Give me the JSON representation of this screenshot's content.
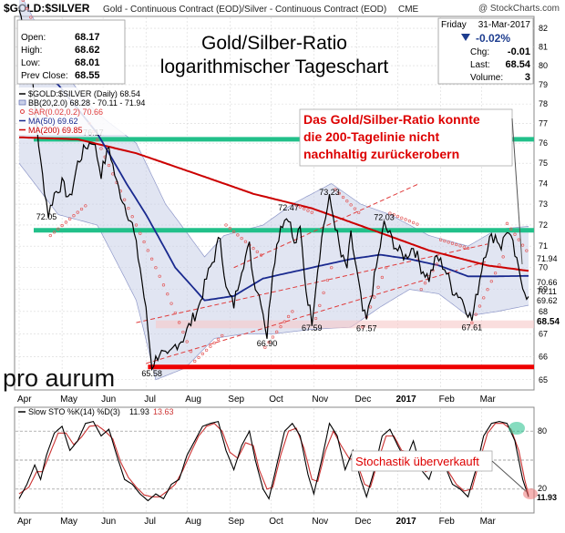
{
  "header": {
    "symbol": "$GOLD:$SILVER",
    "description": "Gold - Continuous Contract (EOD)/Silver - Continuous Contract (EOD)",
    "exchange": "CME",
    "copyright": "@ StockCharts.com"
  },
  "quote_box": {
    "open_label": "Open:",
    "open": "68.17",
    "high_label": "High:",
    "high": "68.62",
    "low_label": "Low:",
    "low": "68.01",
    "prev_label": "Prev Close:",
    "prev": "68.55"
  },
  "chart_title": {
    "line1": "Gold/Silber-Ratio",
    "line2": "logarithmischer Tageschart"
  },
  "right_box": {
    "day": "Friday",
    "date": "31-Mar-2017",
    "change_pct": "-0.02%",
    "chg_label": "Chg:",
    "chg": "-0.01",
    "last_label": "Last:",
    "last": "68.54",
    "vol_label": "Volume:",
    "vol": "3"
  },
  "legend": [
    {
      "text": "$GOLD:$SILVER (Daily) 68.54",
      "color": "#000000"
    },
    {
      "text": "BB(20,2.0) 68.28 - 70.11 - 71.94",
      "color": "#4b5aa6"
    },
    {
      "text": "SAR(0.02,0.2) 70.66",
      "color": "#e03b3b"
    },
    {
      "text": "MA(50) 69.62",
      "color": "#1a2a8f"
    },
    {
      "text": "MA(200) 69.85",
      "color": "#cc0000"
    }
  ],
  "annotation_main": {
    "line1": "Das Gold/Silber-Ratio konnte",
    "line2": "die 200-Tagelinie nicht",
    "line3": "nachhaltig zurückerobern"
  },
  "annotation_stoch": "Stochastik überverkauft",
  "watermark": "pro aurum",
  "right_value_labels": [
    "71.94",
    "70.66",
    "70.11",
    "69.62",
    "68.54"
  ],
  "stoch_legend": {
    "label": "Slow STO %K(14) %D(3)",
    "k": "11.93",
    "d": "13.63"
  },
  "stoch_right_label": "11.93",
  "stoch_ticks": [
    "80",
    "20"
  ],
  "colors": {
    "price": "#000000",
    "ma50": "#1a2a8f",
    "ma200": "#cc0000",
    "sar": "#e35a5a",
    "bb_fill": "#c9cfe8",
    "green": "#22c08a",
    "red": "#ee0000",
    "annotation": "#dd0000",
    "grid": "#d8d8d8"
  },
  "chart_data": {
    "type": "line",
    "y_scale": "log",
    "ylim": [
      64.6,
      82.6
    ],
    "yticks": [
      65,
      66,
      67,
      68,
      69,
      70,
      71,
      72,
      73,
      74,
      75,
      76,
      77,
      78,
      79,
      80,
      81,
      82
    ],
    "x_months": [
      {
        "label": "Apr",
        "i": 0
      },
      {
        "label": "May",
        "i": 22
      },
      {
        "label": "Jun",
        "i": 43
      },
      {
        "label": "Jul",
        "i": 65
      },
      {
        "label": "Aug",
        "i": 86
      },
      {
        "label": "Sep",
        "i": 108
      },
      {
        "label": "Oct",
        "i": 129
      },
      {
        "label": "Nov",
        "i": 151
      },
      {
        "label": "Dec",
        "i": 173
      },
      {
        "label": "2017",
        "i": 194
      },
      {
        "label": "Feb",
        "i": 216
      },
      {
        "label": "Mar",
        "i": 237
      }
    ],
    "n_days": 262,
    "price_keypoints": [
      [
        0,
        83.0
      ],
      [
        4,
        81.5
      ],
      [
        8,
        78.0
      ],
      [
        11,
        75.0
      ],
      [
        15,
        72.5
      ],
      [
        18,
        73.5
      ],
      [
        22,
        74.0
      ],
      [
        26,
        73.2
      ],
      [
        30,
        75.0
      ],
      [
        34,
        75.8
      ],
      [
        38,
        76.17
      ],
      [
        42,
        74.5
      ],
      [
        46,
        75.8
      ],
      [
        50,
        74.0
      ],
      [
        54,
        73.0
      ],
      [
        58,
        72.0
      ],
      [
        62,
        70.0
      ],
      [
        65,
        68.0
      ],
      [
        68,
        65.58
      ],
      [
        72,
        66.2
      ],
      [
        76,
        65.9
      ],
      [
        80,
        66.5
      ],
      [
        84,
        66.8
      ],
      [
        88,
        67.5
      ],
      [
        92,
        68.2
      ],
      [
        96,
        69.5
      ],
      [
        100,
        70.5
      ],
      [
        103,
        71.5
      ],
      [
        106,
        69.0
      ],
      [
        110,
        68.3
      ],
      [
        114,
        70.0
      ],
      [
        118,
        71.0
      ],
      [
        120,
        69.5
      ],
      [
        124,
        68.5
      ],
      [
        127,
        66.9
      ],
      [
        130,
        70.0
      ],
      [
        134,
        72.0
      ],
      [
        138,
        72.47
      ],
      [
        141,
        71.0
      ],
      [
        144,
        71.8
      ],
      [
        147,
        69.0
      ],
      [
        150,
        67.59
      ],
      [
        153,
        70.0
      ],
      [
        156,
        72.0
      ],
      [
        159,
        73.23
      ],
      [
        162,
        72.0
      ],
      [
        165,
        70.5
      ],
      [
        168,
        70.0
      ],
      [
        170,
        71.5
      ],
      [
        173,
        69.8
      ],
      [
        176,
        68.0
      ],
      [
        178,
        67.57
      ],
      [
        181,
        69.0
      ],
      [
        184,
        70.5
      ],
      [
        187,
        72.03
      ],
      [
        190,
        71.5
      ],
      [
        194,
        70.8
      ],
      [
        198,
        70.5
      ],
      [
        202,
        71.0
      ],
      [
        206,
        70.0
      ],
      [
        210,
        69.5
      ],
      [
        214,
        70.5
      ],
      [
        218,
        70.0
      ],
      [
        222,
        69.0
      ],
      [
        226,
        68.7
      ],
      [
        230,
        68.0
      ],
      [
        232,
        67.61
      ],
      [
        235,
        69.0
      ],
      [
        238,
        70.5
      ],
      [
        241,
        71.3
      ],
      [
        244,
        71.5
      ],
      [
        247,
        71.0
      ],
      [
        250,
        71.8
      ],
      [
        253,
        71.0
      ],
      [
        256,
        69.8
      ],
      [
        259,
        69.0
      ],
      [
        261,
        68.54
      ]
    ],
    "ma50_keypoints": [
      [
        0,
        80.5
      ],
      [
        20,
        79.0
      ],
      [
        40,
        76.5
      ],
      [
        55,
        74.0
      ],
      [
        65,
        72.5
      ],
      [
        80,
        70.0
      ],
      [
        95,
        68.5
      ],
      [
        110,
        68.7
      ],
      [
        125,
        69.5
      ],
      [
        140,
        69.8
      ],
      [
        155,
        70.1
      ],
      [
        170,
        70.4
      ],
      [
        185,
        70.6
      ],
      [
        200,
        70.4
      ],
      [
        215,
        70.1
      ],
      [
        230,
        69.6
      ],
      [
        245,
        69.6
      ],
      [
        261,
        69.62
      ]
    ],
    "ma200_keypoints": [
      [
        0,
        76.3
      ],
      [
        30,
        76.2
      ],
      [
        60,
        75.5
      ],
      [
        90,
        74.5
      ],
      [
        120,
        73.5
      ],
      [
        150,
        72.8
      ],
      [
        180,
        71.8
      ],
      [
        210,
        70.8
      ],
      [
        240,
        70.1
      ],
      [
        261,
        69.85
      ]
    ],
    "bb_upper_keypoints": [
      [
        0,
        84.0
      ],
      [
        20,
        80.0
      ],
      [
        40,
        77.5
      ],
      [
        60,
        76.0
      ],
      [
        75,
        73.0
      ],
      [
        95,
        70.5
      ],
      [
        105,
        71.5
      ],
      [
        125,
        72.0
      ],
      [
        140,
        73.0
      ],
      [
        160,
        74.0
      ],
      [
        175,
        73.0
      ],
      [
        190,
        72.5
      ],
      [
        210,
        71.5
      ],
      [
        230,
        71.0
      ],
      [
        245,
        71.8
      ],
      [
        261,
        71.94
      ]
    ],
    "bb_lower_keypoints": [
      [
        0,
        75.0
      ],
      [
        20,
        72.5
      ],
      [
        40,
        72.0
      ],
      [
        60,
        68.5
      ],
      [
        70,
        65.0
      ],
      [
        85,
        65.5
      ],
      [
        100,
        66.8
      ],
      [
        115,
        67.0
      ],
      [
        130,
        67.0
      ],
      [
        150,
        67.2
      ],
      [
        170,
        67.3
      ],
      [
        185,
        68.2
      ],
      [
        200,
        69.0
      ],
      [
        215,
        68.8
      ],
      [
        230,
        67.8
      ],
      [
        245,
        68.0
      ],
      [
        261,
        68.28
      ]
    ],
    "sar_keypoints": [
      [
        0,
        84.0
      ],
      [
        15,
        80.5
      ],
      [
        16,
        71.5
      ],
      [
        35,
        73.0
      ],
      [
        36,
        77.0
      ],
      [
        55,
        73.0
      ],
      [
        75,
        69.0
      ],
      [
        90,
        65.8
      ],
      [
        105,
        67.0
      ],
      [
        106,
        72.0
      ],
      [
        125,
        70.5
      ],
      [
        126,
        66.4
      ],
      [
        140,
        68.0
      ],
      [
        141,
        73.0
      ],
      [
        150,
        72.6
      ],
      [
        151,
        67.4
      ],
      [
        160,
        70.0
      ],
      [
        161,
        73.8
      ],
      [
        175,
        72.5
      ],
      [
        176,
        67.3
      ],
      [
        188,
        70.0
      ],
      [
        189,
        72.6
      ],
      [
        205,
        72.0
      ],
      [
        206,
        69.0
      ],
      [
        215,
        70.3
      ],
      [
        216,
        71.3
      ],
      [
        230,
        70.9
      ],
      [
        231,
        67.3
      ],
      [
        248,
        70.5
      ],
      [
        249,
        72.2
      ],
      [
        261,
        70.66
      ]
    ],
    "peak_labels": [
      {
        "i": 38,
        "v": 76.17,
        "text": "76.17"
      },
      {
        "i": 14,
        "v": 72.05,
        "text": "72.05"
      },
      {
        "i": 68,
        "v": 65.58,
        "text": "65.58"
      },
      {
        "i": 127,
        "v": 66.9,
        "text": "66.90"
      },
      {
        "i": 138,
        "v": 72.47,
        "text": "72.47"
      },
      {
        "i": 150,
        "v": 67.59,
        "text": "67.59"
      },
      {
        "i": 159,
        "v": 73.23,
        "text": "73.23"
      },
      {
        "i": 178,
        "v": 67.57,
        "text": "67.57"
      },
      {
        "i": 187,
        "v": 72.03,
        "text": "72.03"
      },
      {
        "i": 232,
        "v": 67.61,
        "text": "67.61"
      }
    ],
    "horizontal_lines": [
      {
        "value": 76.2,
        "color": "#22c08a"
      },
      {
        "value": 71.75,
        "color": "#22c08a"
      },
      {
        "value": 65.55,
        "color": "#ee0000"
      }
    ],
    "pink_band": [
      67.25,
      67.6
    ],
    "trendlines": [
      {
        "from": [
          65,
          65.7
        ],
        "to": [
          240,
          70.3
        ]
      },
      {
        "from": [
          60,
          67.5
        ],
        "to": [
          240,
          71.1
        ]
      },
      {
        "from": [
          110,
          70.0
        ],
        "to": [
          205,
          74.0
        ]
      }
    ],
    "stochastic": {
      "ylim": [
        0,
        100
      ],
      "k_keypoints": [
        [
          0,
          10
        ],
        [
          4,
          25
        ],
        [
          8,
          45
        ],
        [
          11,
          30
        ],
        [
          14,
          55
        ],
        [
          18,
          78
        ],
        [
          22,
          85
        ],
        [
          26,
          60
        ],
        [
          30,
          70
        ],
        [
          34,
          88
        ],
        [
          38,
          90
        ],
        [
          42,
          75
        ],
        [
          46,
          82
        ],
        [
          50,
          55
        ],
        [
          54,
          30
        ],
        [
          58,
          25
        ],
        [
          62,
          15
        ],
        [
          66,
          8
        ],
        [
          70,
          15
        ],
        [
          74,
          10
        ],
        [
          78,
          25
        ],
        [
          82,
          30
        ],
        [
          86,
          55
        ],
        [
          90,
          70
        ],
        [
          94,
          85
        ],
        [
          98,
          88
        ],
        [
          102,
          90
        ],
        [
          106,
          60
        ],
        [
          110,
          40
        ],
        [
          114,
          65
        ],
        [
          118,
          80
        ],
        [
          121,
          50
        ],
        [
          125,
          20
        ],
        [
          128,
          10
        ],
        [
          132,
          45
        ],
        [
          136,
          80
        ],
        [
          140,
          88
        ],
        [
          144,
          75
        ],
        [
          148,
          35
        ],
        [
          151,
          15
        ],
        [
          155,
          50
        ],
        [
          159,
          88
        ],
        [
          163,
          75
        ],
        [
          167,
          40
        ],
        [
          171,
          60
        ],
        [
          175,
          30
        ],
        [
          178,
          12
        ],
        [
          182,
          40
        ],
        [
          186,
          75
        ],
        [
          190,
          82
        ],
        [
          194,
          65
        ],
        [
          198,
          50
        ],
        [
          202,
          70
        ],
        [
          206,
          40
        ],
        [
          210,
          30
        ],
        [
          214,
          55
        ],
        [
          218,
          45
        ],
        [
          222,
          25
        ],
        [
          226,
          20
        ],
        [
          230,
          12
        ],
        [
          234,
          40
        ],
        [
          238,
          75
        ],
        [
          242,
          88
        ],
        [
          246,
          90
        ],
        [
          250,
          88
        ],
        [
          254,
          70
        ],
        [
          258,
          30
        ],
        [
          261,
          11.93
        ]
      ],
      "d_keypoints": [
        [
          0,
          15
        ],
        [
          5,
          22
        ],
        [
          9,
          38
        ],
        [
          12,
          38
        ],
        [
          16,
          58
        ],
        [
          20,
          78
        ],
        [
          24,
          78
        ],
        [
          28,
          66
        ],
        [
          32,
          74
        ],
        [
          36,
          85
        ],
        [
          40,
          86
        ],
        [
          44,
          80
        ],
        [
          48,
          72
        ],
        [
          52,
          48
        ],
        [
          56,
          32
        ],
        [
          60,
          22
        ],
        [
          64,
          14
        ],
        [
          68,
          12
        ],
        [
          72,
          12
        ],
        [
          76,
          18
        ],
        [
          80,
          25
        ],
        [
          84,
          40
        ],
        [
          88,
          58
        ],
        [
          92,
          75
        ],
        [
          96,
          85
        ],
        [
          100,
          88
        ],
        [
          104,
          80
        ],
        [
          108,
          58
        ],
        [
          112,
          52
        ],
        [
          116,
          68
        ],
        [
          120,
          65
        ],
        [
          123,
          40
        ],
        [
          127,
          20
        ],
        [
          130,
          22
        ],
        [
          134,
          55
        ],
        [
          138,
          80
        ],
        [
          142,
          83
        ],
        [
          146,
          62
        ],
        [
          150,
          30
        ],
        [
          153,
          28
        ],
        [
          157,
          60
        ],
        [
          161,
          80
        ],
        [
          165,
          65
        ],
        [
          169,
          52
        ],
        [
          173,
          48
        ],
        [
          177,
          25
        ],
        [
          180,
          22
        ],
        [
          184,
          50
        ],
        [
          188,
          75
        ],
        [
          192,
          75
        ],
        [
          196,
          60
        ],
        [
          200,
          58
        ],
        [
          204,
          58
        ],
        [
          208,
          38
        ],
        [
          212,
          40
        ],
        [
          216,
          50
        ],
        [
          220,
          38
        ],
        [
          224,
          25
        ],
        [
          228,
          18
        ],
        [
          232,
          20
        ],
        [
          236,
          50
        ],
        [
          240,
          78
        ],
        [
          244,
          88
        ],
        [
          248,
          88
        ],
        [
          252,
          82
        ],
        [
          256,
          60
        ],
        [
          259,
          30
        ],
        [
          261,
          13.63
        ]
      ]
    }
  }
}
